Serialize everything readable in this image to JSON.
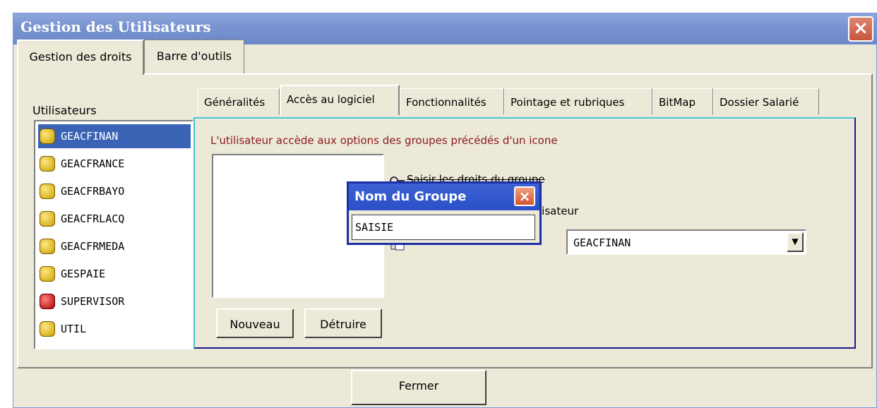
{
  "window": {
    "title": "Gestion des Utilisateurs"
  },
  "outer_tabs": [
    "Gestion des droits",
    "Barre d'outils"
  ],
  "users": {
    "label": "Utilisateurs",
    "items": [
      "GEACFINAN",
      "GEACFRANCE",
      "GEACFRBAYO",
      "GEACFRLACQ",
      "GEACFRMEDA",
      "GESPAIE",
      "SUPERVISOR",
      "UTIL"
    ],
    "selected": "GEACFINAN"
  },
  "inner_tabs": [
    "Généralités",
    "Accès au logiciel",
    "Fonctionnalités",
    "Pointage et rubriques",
    "BitMap",
    "Dossier Salarié"
  ],
  "panel": {
    "hint": "L'utilisateur accède aux options des groupes précédés d'un icone",
    "option1": "Saisir les droits du groupe",
    "option2": "lisateur",
    "combo_value": "GEACFINAN",
    "new_button": "Nouveau",
    "delete_button": "Détruire"
  },
  "dialog": {
    "title": "Nom du Groupe",
    "input_value": "SAISIE"
  },
  "footer": {
    "close_button": "Fermer"
  }
}
